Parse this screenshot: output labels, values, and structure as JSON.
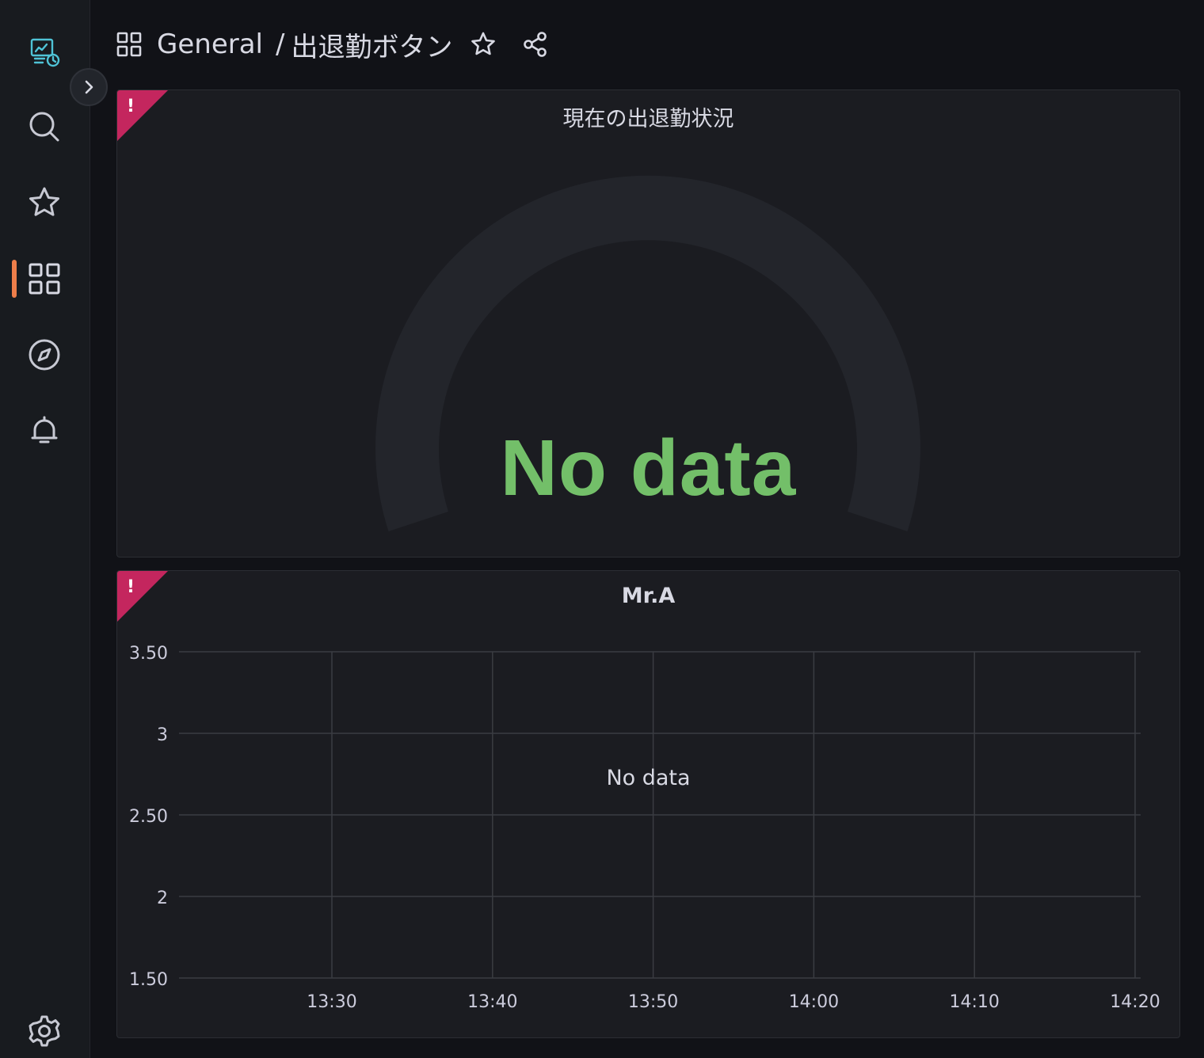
{
  "sidebar": {
    "items": [
      {
        "name": "grafana-logo-icon"
      },
      {
        "name": "search-icon"
      },
      {
        "name": "starred-icon"
      },
      {
        "name": "dashboards-icon"
      },
      {
        "name": "explore-icon"
      },
      {
        "name": "alerting-icon"
      },
      {
        "name": "settings-icon"
      }
    ],
    "active": "dashboards-icon",
    "accent_color": "#ee7e4a"
  },
  "header": {
    "folder": "General",
    "separator": "/",
    "dashboard_title": "出退勤ボタン",
    "icons": [
      "dashboard-grid-icon",
      "star-icon",
      "share-icon"
    ]
  },
  "panels": [
    {
      "title": "現在の出退勤状況",
      "type": "gauge",
      "value_text": "No data",
      "value_color": "#73bf69",
      "error_indicator": "!"
    },
    {
      "title": "Mr.A",
      "type": "timeseries",
      "empty_text": "No data",
      "error_indicator": "!"
    }
  ],
  "chart_data": {
    "type": "line",
    "title": "Mr.A",
    "series": [],
    "x": [],
    "x_ticks": [
      "13:30",
      "13:40",
      "13:50",
      "14:00",
      "14:10",
      "14:20"
    ],
    "y_ticks": [
      "3.50",
      "3",
      "2.50",
      "2",
      "1.50"
    ],
    "ylim": [
      1.5,
      3.5
    ],
    "grid": true,
    "annotation": "No data"
  }
}
